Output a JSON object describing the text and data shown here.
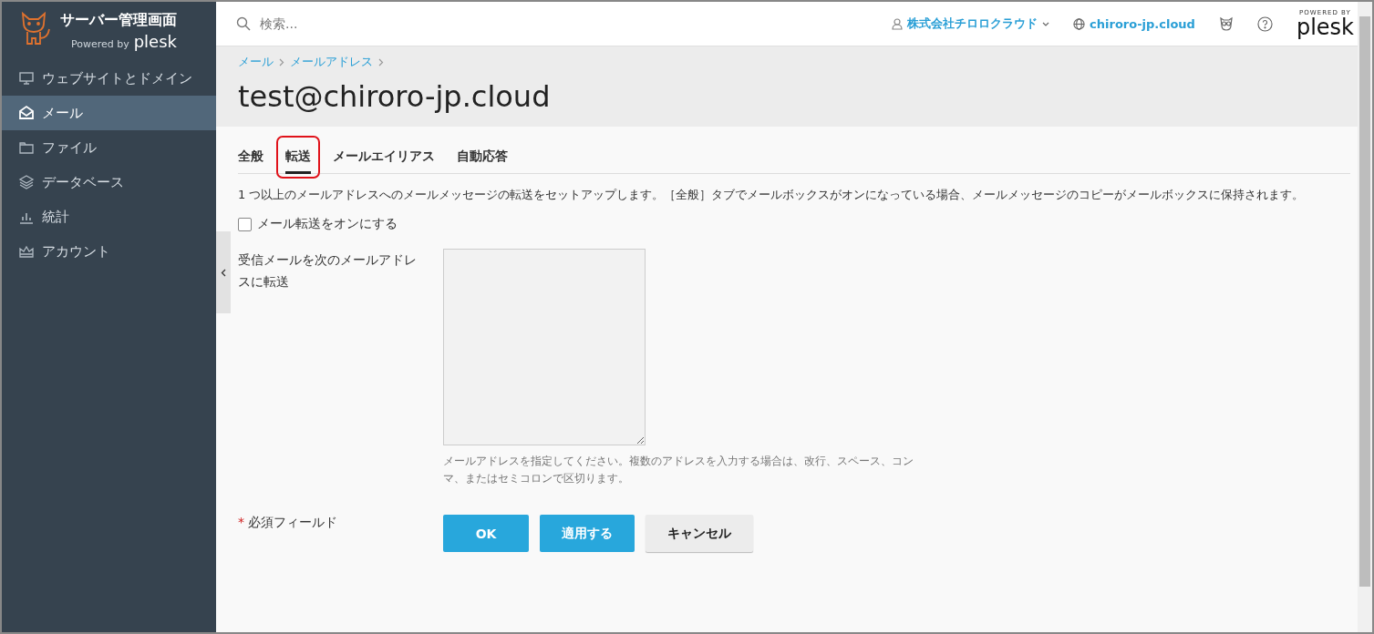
{
  "sidebar": {
    "title": "サーバー管理画面",
    "powered_by": "Powered by",
    "brand": "plesk",
    "items": [
      {
        "label": "ウェブサイトとドメイン",
        "selected": false
      },
      {
        "label": "メール",
        "selected": true
      },
      {
        "label": "ファイル",
        "selected": false
      },
      {
        "label": "データベース",
        "selected": false
      },
      {
        "label": "統計",
        "selected": false
      },
      {
        "label": "アカウント",
        "selected": false
      }
    ]
  },
  "topbar": {
    "search_placeholder": "検索...",
    "account": "株式会社チロロクラウド",
    "domain": "chiroro-jp.cloud",
    "powered_by": "POWERED BY",
    "brand": "plesk"
  },
  "breadcrumbs": [
    "メール",
    "メールアドレス"
  ],
  "page_title": "test@chiroro-jp.cloud",
  "tabs": [
    {
      "label": "全般",
      "selected": false,
      "annotated": false
    },
    {
      "label": "転送",
      "selected": true,
      "annotated": true
    },
    {
      "label": "メールエイリアス",
      "selected": false,
      "annotated": false
    },
    {
      "label": "自動応答",
      "selected": false,
      "annotated": false
    }
  ],
  "description": "1 つ以上のメールアドレスへのメールメッセージの転送をセットアップします。［全般］タブでメールボックスがオンになっている場合、メールメッセージのコピーがメールボックスに保持されます。",
  "forwarding_checkbox": {
    "label": "メール転送をオンにする",
    "checked": false
  },
  "forward_field": {
    "label": "受信メールを次のメールアドレスに転送",
    "hint": "メールアドレスを指定してください。複数のアドレスを入力する場合は、改行、スペース、コンマ、またはセミコロンで区切ります。"
  },
  "required_note": {
    "mark": "*",
    "label": "必須フィールド"
  },
  "buttons": [
    {
      "label": "OK",
      "kind": "primary"
    },
    {
      "label": "適用する",
      "kind": "primary"
    },
    {
      "label": "キャンセル",
      "kind": "secondary"
    }
  ]
}
